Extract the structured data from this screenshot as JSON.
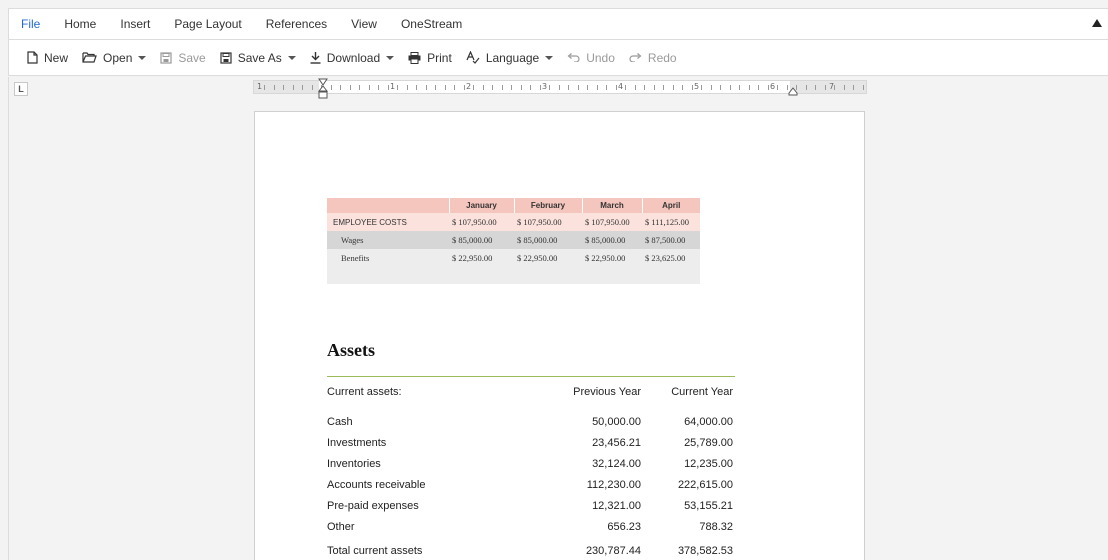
{
  "tabs": [
    "File",
    "Home",
    "Insert",
    "Page Layout",
    "References",
    "View",
    "OneStream"
  ],
  "toolbar": {
    "new": "New",
    "open": "Open",
    "save": "Save",
    "save_as": "Save As",
    "download": "Download",
    "print": "Print",
    "language": "Language",
    "undo": "Undo",
    "redo": "Redo"
  },
  "corner": "L",
  "ruler_numbers": [
    "1",
    "1",
    "2",
    "3",
    "4",
    "5",
    "6",
    "7"
  ],
  "employee_table": {
    "headers": [
      "January",
      "February",
      "March",
      "April"
    ],
    "rows": [
      {
        "label": "EMPLOYEE COSTS",
        "values": [
          "$ 107,950.00",
          "$ 107,950.00",
          "$ 107,950.00",
          "$ 111,125.00"
        ]
      },
      {
        "label": "Wages",
        "values": [
          "$ 85,000.00",
          "$ 85,000.00",
          "$ 85,000.00",
          "$ 87,500.00"
        ]
      },
      {
        "label": "Benefits",
        "values": [
          "$ 22,950.00",
          "$ 22,950.00",
          "$ 22,950.00",
          "$ 23,625.00"
        ]
      }
    ]
  },
  "assets": {
    "title": "Assets",
    "header": [
      "Current assets:",
      "Previous Year",
      "Current Year"
    ],
    "rows": [
      [
        "Cash",
        "50,000.00",
        "64,000.00"
      ],
      [
        "Investments",
        "23,456.21",
        "25,789.00"
      ],
      [
        "Inventories",
        "32,124.00",
        "12,235.00"
      ],
      [
        "Accounts receivable",
        "112,230.00",
        "222,615.00"
      ],
      [
        "Pre-paid expenses",
        "12,321.00",
        "53,155.21"
      ],
      [
        "Other",
        "656.23",
        "788.32"
      ]
    ],
    "total": [
      "Total current assets",
      "230,787.44",
      "378,582.53"
    ]
  }
}
